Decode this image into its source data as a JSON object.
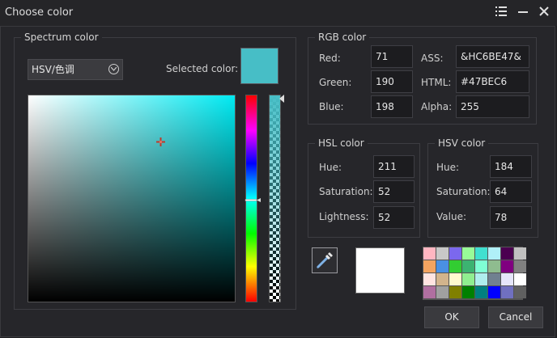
{
  "window": {
    "title": "Choose color"
  },
  "spectrum": {
    "title": "Spectrum color",
    "mode": "HSV/色调",
    "selected_label": "Selected color:",
    "selected_color": "#47BEC6"
  },
  "rgb": {
    "title": "RGB color",
    "red_label": "Red:",
    "red": "71",
    "green_label": "Green:",
    "green": "190",
    "blue_label": "Blue:",
    "blue": "198",
    "ass_label": "ASS:",
    "ass": "&HC6BE47&",
    "html_label": "HTML:",
    "html": "#47BEC6",
    "alpha_label": "Alpha:",
    "alpha": "255"
  },
  "hsl": {
    "title": "HSL color",
    "hue_label": "Hue:",
    "hue": "211",
    "sat_label": "Saturation:",
    "sat": "52",
    "light_label": "Lightness:",
    "light": "52"
  },
  "hsv": {
    "title": "HSV color",
    "hue_label": "Hue:",
    "hue": "184",
    "sat_label": "Saturation:",
    "sat": "64",
    "val_label": "Value:",
    "val": "78"
  },
  "buttons": {
    "ok": "OK",
    "cancel": "Cancel"
  },
  "palette": [
    "#ffb6c1",
    "#c8c8c8",
    "#7b68ee",
    "#98fb98",
    "#40e0d0",
    "#b0f0f8",
    "#4b0050",
    "#c0c0c0",
    "#f4a460",
    "#4a90e2",
    "#32cd32",
    "#3cb371",
    "#7fffd4",
    "#8fbc8f",
    "#800080",
    "#808080",
    "#ffe4e1",
    "#d2b48c",
    "#fffacd",
    "#90ee90",
    "#afeeee",
    "#708090",
    "#e6e6fa",
    "#ffffff",
    "#b06fa0",
    "#a0a0a0",
    "#808000",
    "#008000",
    "#008080",
    "#0000ff",
    "#7070c0",
    "#606060"
  ]
}
